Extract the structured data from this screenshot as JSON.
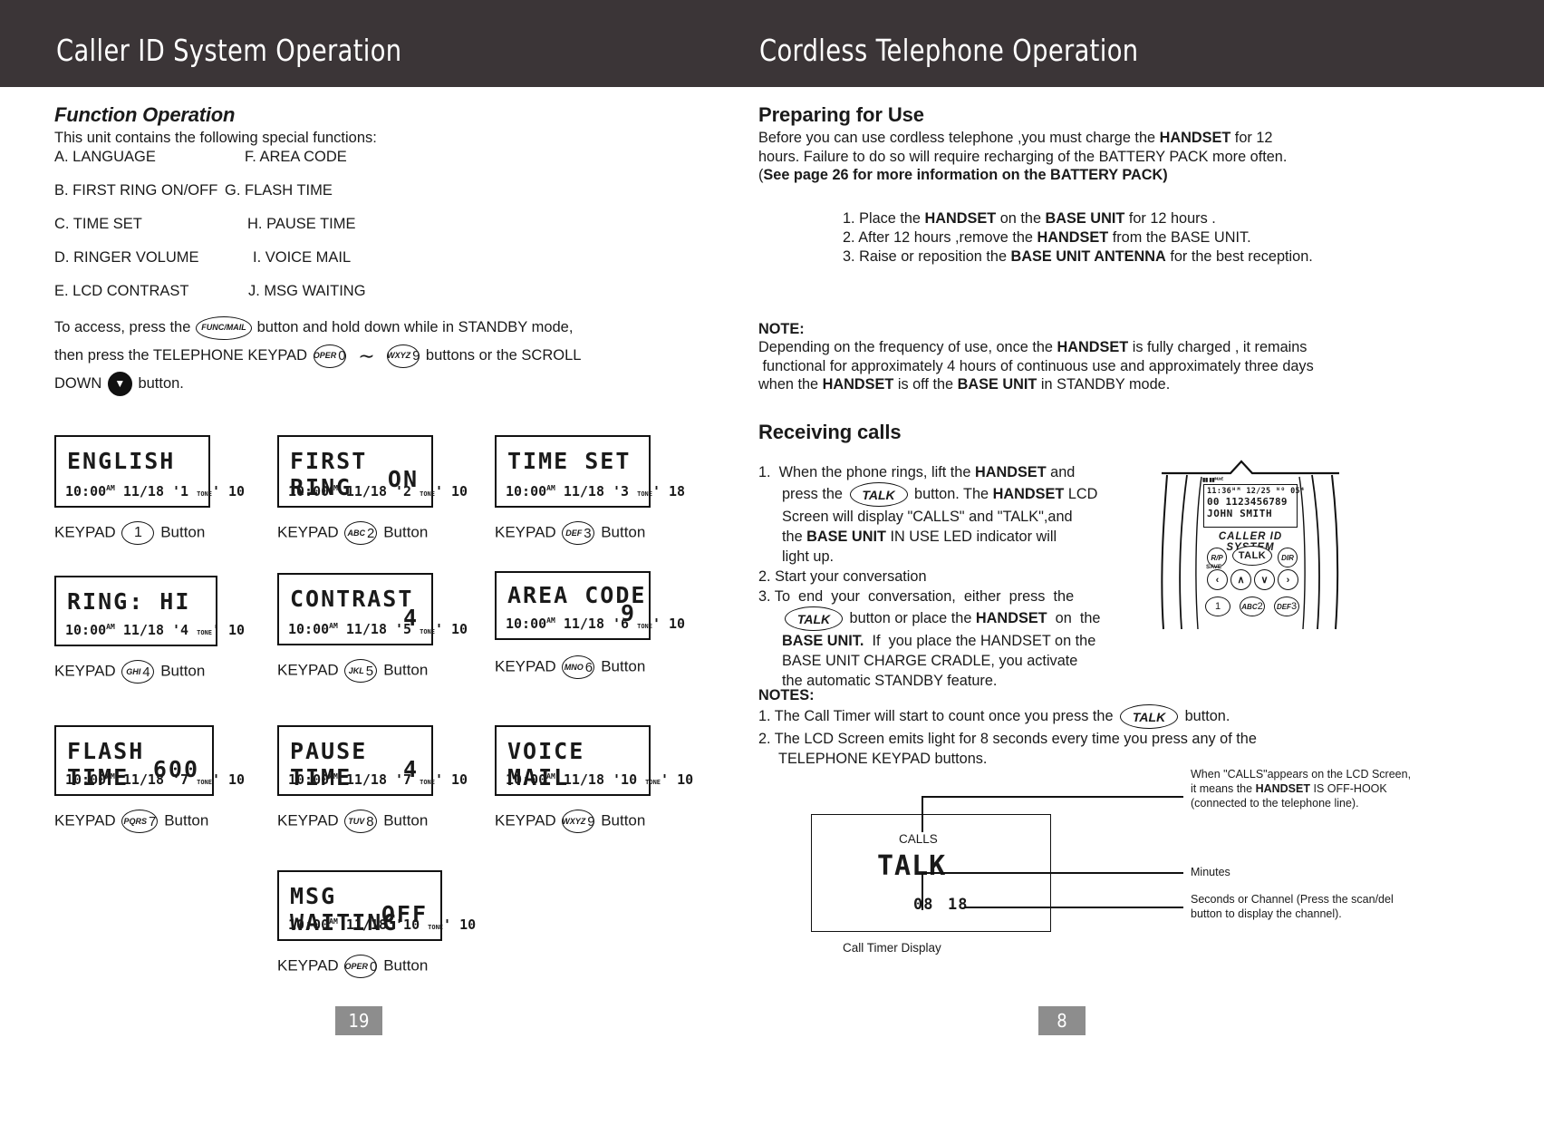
{
  "header": {
    "left_title": "Caller ID System Operation",
    "right_title": "Cordless Telephone Operation"
  },
  "left": {
    "section_title": "Function Operation",
    "intro": "This unit contains the following special functions:",
    "functions": [
      {
        "left": "A. LANGUAGE",
        "right": "F. AREA CODE"
      },
      {
        "left": "B. FIRST RING ON/OFF",
        "right": "G. FLASH TIME"
      },
      {
        "left": "C. TIME SET",
        "right": "H. PAUSE TIME"
      },
      {
        "left": "D. RINGER VOLUME",
        "right": "I. VOICE MAIL"
      },
      {
        "left": "E. LCD CONTRAST",
        "right": "J. MSG WAITING"
      }
    ],
    "access": {
      "l1_a": "To access, press the",
      "func_key_small": "FUNC",
      "func_key_rest": "/MAIL",
      "l1_b": "button and hold down while in STANDBY mode,",
      "l2_a": "then press the  TELEPHONE KEYPAD",
      "key0_letters": "OPER",
      "key0_digit": "0",
      "tilde": "∼",
      "key9_letters": "WXYZ",
      "key9_digit": "9",
      "l2_b": "buttons or the SCROLL",
      "l3_a": "DOWN",
      "down_icon": "▼",
      "l3_b": "button."
    },
    "screens": [
      {
        "title": "ENGLISH",
        "value": "",
        "status_time": "10:00",
        "status_ampm": "AM",
        "status_date": "11/18",
        "status_idx": "1",
        "status_tone": "TONE",
        "status_ch": "10",
        "keypad_prefix": "KEYPAD",
        "keypad_letters": "",
        "keypad_digit": "1",
        "keypad_suffix": "Button"
      },
      {
        "title": "FIRST RING",
        "value": "ON",
        "status_time": "10:00",
        "status_ampm": "AM",
        "status_date": "11/18",
        "status_idx": "2",
        "status_tone": "TONE",
        "status_ch": "10",
        "keypad_prefix": "KEYPAD",
        "keypad_letters": "ABC",
        "keypad_digit": "2",
        "keypad_suffix": "Button"
      },
      {
        "title": "TIME SET",
        "value": "",
        "status_time": "10:00",
        "status_ampm": "AM",
        "status_date": "11/18",
        "status_idx": "3",
        "status_tone": "TONE",
        "status_ch": "18",
        "keypad_prefix": "KEYPAD",
        "keypad_letters": "DEF",
        "keypad_digit": "3",
        "keypad_suffix": "Button"
      },
      {
        "title": "RING: HI",
        "value": "",
        "status_time": "10:00",
        "status_ampm": "AM",
        "status_date": "11/18",
        "status_idx": "4",
        "status_tone": "TONE",
        "status_ch": "10",
        "keypad_prefix": "KEYPAD",
        "keypad_letters": "GHI",
        "keypad_digit": "4",
        "keypad_suffix": "Button"
      },
      {
        "title": "CONTRAST",
        "value": "4",
        "status_time": "10:00",
        "status_ampm": "AM",
        "status_date": "11/18",
        "status_idx": "5",
        "status_tone": "TONE",
        "status_ch": "10",
        "keypad_prefix": "KEYPAD",
        "keypad_letters": "JKL",
        "keypad_digit": "5",
        "keypad_suffix": "Button"
      },
      {
        "title": "AREA CODE",
        "value": "9",
        "status_time": "10:00",
        "status_ampm": "AM",
        "status_date": "11/18",
        "status_idx": "6",
        "status_tone": "TONE",
        "status_ch": "10",
        "keypad_prefix": "KEYPAD",
        "keypad_letters": "MNO",
        "keypad_digit": "6",
        "keypad_suffix": "Button"
      },
      {
        "title": "FLASH TIME",
        "value": "600",
        "status_time": "10:00",
        "status_ampm": "AM",
        "status_date": "11/18",
        "status_idx": "7",
        "status_tone": "TONE",
        "status_ch": "10",
        "keypad_prefix": "KEYPAD",
        "keypad_letters": "PQRS",
        "keypad_digit": "7",
        "keypad_suffix": "Button"
      },
      {
        "title": "PAUSE TIME",
        "value": "4",
        "status_time": "10:00",
        "status_ampm": "AM",
        "status_date": "11/18",
        "status_idx": "7",
        "status_tone": "TONE",
        "status_ch": "10",
        "keypad_prefix": "KEYPAD",
        "keypad_letters": "TUV",
        "keypad_digit": "8",
        "keypad_suffix": "Button"
      },
      {
        "title": "VOICE MAIL",
        "value": "",
        "status_time": "10:00",
        "status_ampm": "AM",
        "status_date": "11/18",
        "status_idx": "10",
        "status_tone": "TONE",
        "status_ch": "10",
        "keypad_prefix": "KEYPAD",
        "keypad_letters": "WXYZ",
        "keypad_digit": "9",
        "keypad_suffix": "Button"
      },
      {
        "title": "MSG WAITING",
        "value": "OFF",
        "status_time": "10:00",
        "status_ampm": "AM",
        "status_date": "11/18",
        "status_idx": "10",
        "status_tone": "TONE",
        "status_ch": "10",
        "keypad_prefix": "KEYPAD",
        "keypad_letters": "OPER",
        "keypad_digit": "0",
        "keypad_suffix": "Button"
      }
    ],
    "page_number": "19"
  },
  "right": {
    "preparing": {
      "title": "Preparing for Use",
      "p1_a": "Before you can use cordless telephone ,you must charge the ",
      "p1_b": "HANDSET",
      "p1_c": " for 12",
      "p2": " hours. Failure to do so will require recharging of the BATTERY PACK more often.",
      "p3_open": "(",
      "p3_bold": "See page 26 for more information on the BATTERY PACK)",
      "steps": [
        "1. Place the HANDSET on the BASE UNIT for 12 hours  .",
        "2. After 12 hours ,remove the HANDSET from the BASE UNIT.",
        "3. Raise or reposition the BASE UNIT ANTENNA for the best reception."
      ]
    },
    "note": {
      "label": "NOTE:",
      "l1": "Depending on the frequency of use, once the HANDSET is fully charged , it remains",
      "l2": " functional for approximately 4 hours of continuous use and approximately three days",
      "l3": "when the HANDSET is off the BASE UNIT in STANDBY mode."
    },
    "receiving": {
      "title": "Receiving calls",
      "items": [
        "1.  When the phone rings, lift the HANDSET and",
        "press the TALK button. The HANDSET LCD",
        "Screen will display \"CALLS\" and  \"TALK\",and",
        "the BASE UNIT IN USE LED indicator will",
        "light up.",
        "2. Start your conversation",
        "3. To  end  your  conversation,  either  press  the",
        "TALK button or place the HANDSET  on  the",
        "BASE UNIT.  If  you place the HANDSET on the",
        "BASE UNIT CHARGE CRADLE, you activate",
        "the automatic STANDBY feature."
      ]
    },
    "notes": {
      "label": "NOTES:",
      "n1_a": "1. The Call Timer will start to count once you press the",
      "n1_talk": "TALK",
      "n1_b": "button.",
      "n2_a": "2. The LCD Screen emits light for 8 seconds every time you press any of the",
      "n2_b": "TELEPHONE KEYPAD buttons."
    },
    "handset": {
      "lcd_line1": "11:36ᴴᴹ 12/25 ᴺᴼ 05⁴",
      "lcd_line2": "00 1123456789",
      "lcd_line3": "JOHN SMITH",
      "brand": "CALLER ID SYSTEM",
      "btn_rp": "R/P",
      "btn_save": "SAVE",
      "btn_talk": "TALK",
      "btn_dir": "DIR",
      "btn_left": "‹",
      "btn_up": "∧",
      "btn_down": "∨",
      "btn_right": "›",
      "key1_letters": "",
      "key1_digit": "1",
      "key2_letters": "ABC",
      "key2_digit": "2",
      "key3_letters": "DEF",
      "key3_digit": "3"
    },
    "call_timer": {
      "calls_label": "CALLS",
      "talk_text": "TALK",
      "minutes_digits": "08",
      "seconds_digits": "18",
      "caption": "Call Timer Display",
      "note_l1": "When \"CALLS\"appears on the LCD Screen,",
      "note_l2_a": "it  means the ",
      "note_l2_b": "HANDSET",
      "note_l2_c": " IS OFF-HOOK",
      "note_l3": "(connected to the telephone line).",
      "minutes_label": "Minutes",
      "seconds_label_l1": "Seconds or Channel (Press the scan/del",
      "seconds_label_l2": "button to display the channel)."
    },
    "page_number": "8"
  },
  "colors": {
    "header_bg": "#3b3537",
    "page_badge": "#8d8d8d",
    "ink": "#111111"
  }
}
